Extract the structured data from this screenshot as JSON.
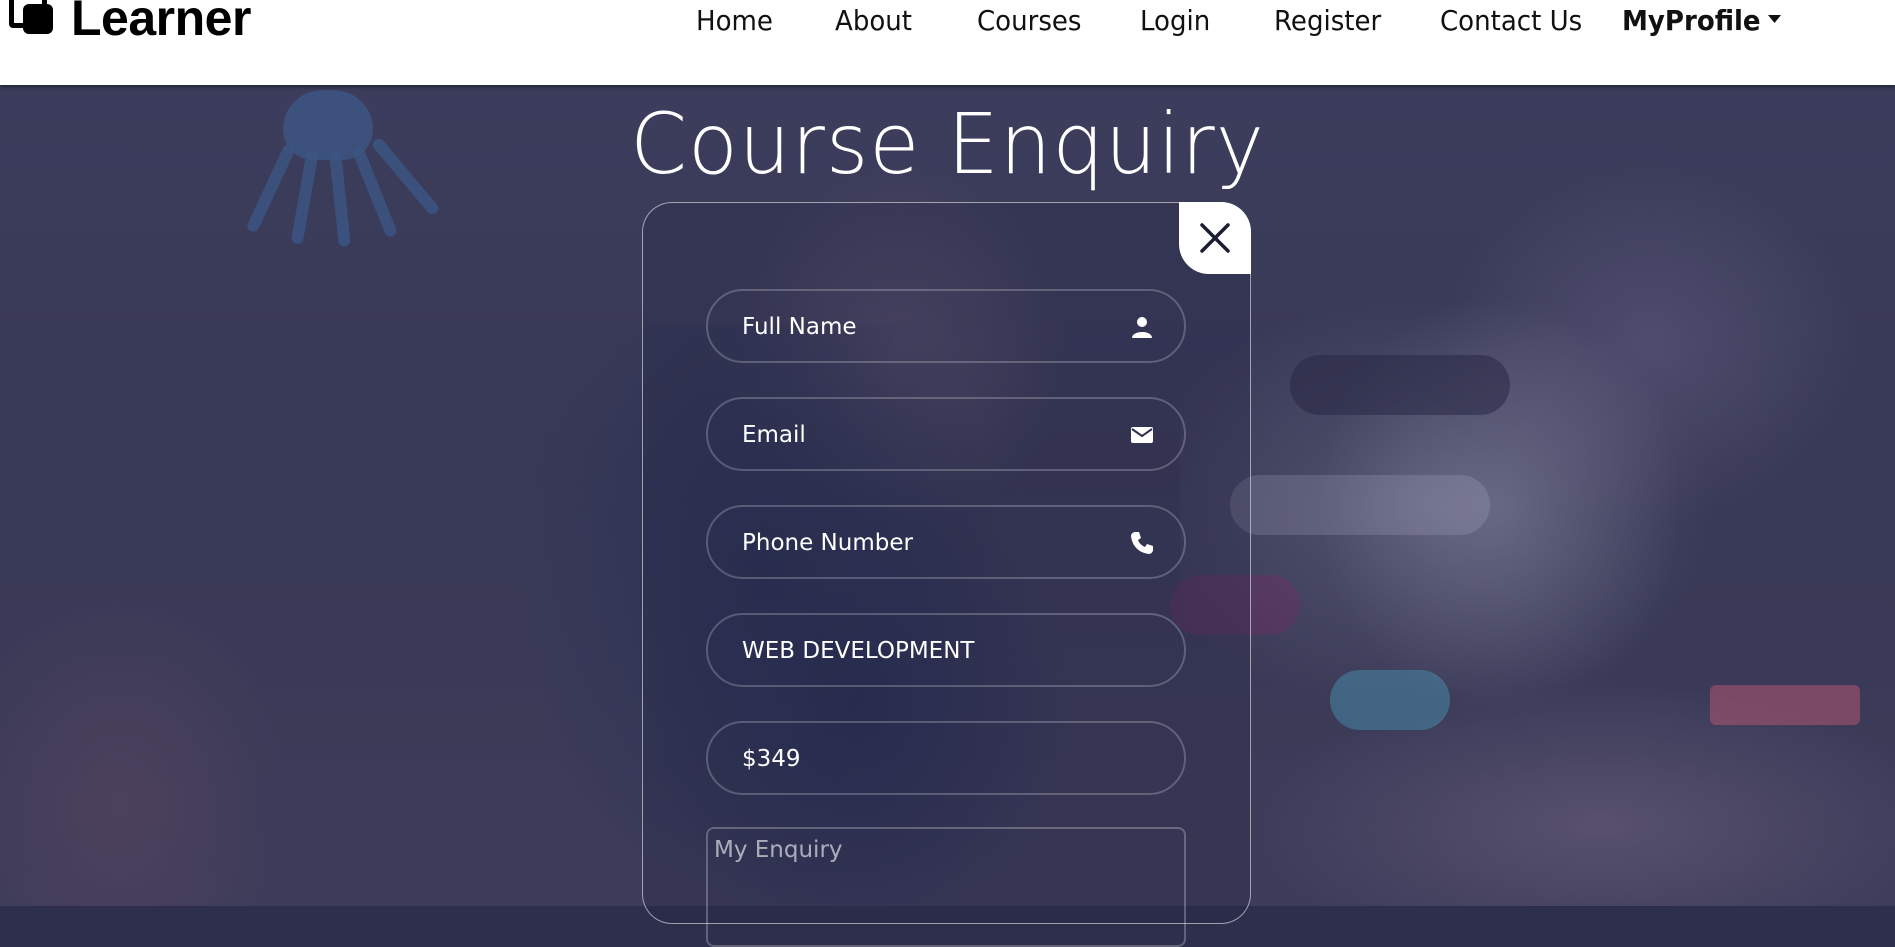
{
  "brand": {
    "name": "Learner"
  },
  "nav": {
    "items": [
      {
        "label": "Home"
      },
      {
        "label": "About"
      },
      {
        "label": "Courses"
      },
      {
        "label": "Login"
      },
      {
        "label": "Register"
      },
      {
        "label": "Contact Us"
      }
    ],
    "profile_label": "MyProfile"
  },
  "page": {
    "title": "Course Enquiry"
  },
  "form": {
    "full_name": {
      "placeholder": "Full Name",
      "icon": "user-icon"
    },
    "email": {
      "placeholder": "Email",
      "icon": "envelope-icon"
    },
    "phone": {
      "placeholder": "Phone Number",
      "icon": "phone-icon"
    },
    "course": {
      "value": "WEB DEVELOPMENT"
    },
    "price": {
      "value": "$349"
    },
    "enquiry": {
      "placeholder": "My Enquiry"
    },
    "close_icon": "close-icon"
  }
}
